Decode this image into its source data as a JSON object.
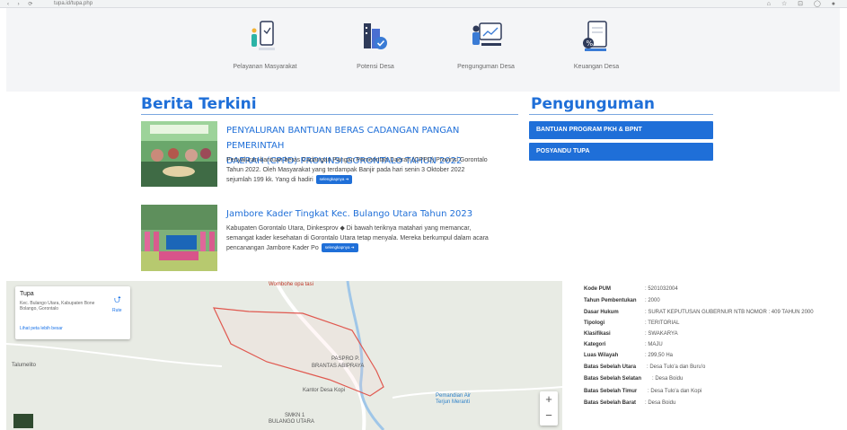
{
  "browser": {
    "url": "tupa.id/tupa.php",
    "nav": "‹ › ⟳",
    "controls": "⌂ ☆ ⊡ ◯ ●"
  },
  "menu": [
    {
      "label": "Pelayanan Masyarakat",
      "icon": "phone-service-icon"
    },
    {
      "label": "Potensi Desa",
      "icon": "buildings-check-icon"
    },
    {
      "label": "Pengunguman Desa",
      "icon": "presentation-board-icon"
    },
    {
      "label": "Keuangan Desa",
      "icon": "finance-document-icon"
    }
  ],
  "news_section": {
    "title": "Berita Terkini",
    "items": [
      {
        "title_lines": [
          "PENYALURAN BANTUAN BERAS CADANGAN PANGAN PEMERINTAH",
          "DAERAH (CPPD) PROVINSI GORONTALO TAHUN 2022"
        ],
        "body_lines": [
          "Penyaluran bantuan beras Cadangan Pangan Pemerintah Daerah (CPPD) Provinsi Gorontalo",
          "Tahun 2022. Oleh Masyarakat yang terdampak Banjir pada hari senin 3 Oktober 2022",
          "sejumlah 199 kk. Yang di hadiri"
        ],
        "more_label": "selengkapnya ➔"
      },
      {
        "title_lines": [
          "Jambore Kader Tingkat Kec. Bulango Utara Tahun 2023"
        ],
        "body_lines": [
          "Kabupaten Gorontalo Utara, Dinkesprov ◆ Di bawah teriknya matahari yang memancar,",
          "semangat kader kesehatan di Gorontalo Utara tetap menyala. Mereka berkumpul dalam acara",
          "pencanangan Jambore Kader Po"
        ],
        "more_label": "selengkapnya ➔"
      }
    ]
  },
  "announcement_section": {
    "title": "Pengunguman",
    "buttons": [
      "BANTUAN PROGRAM PKH & BPNT",
      "POSYANDU TUPA"
    ]
  },
  "map": {
    "place": "Tupa",
    "address": "Kec. Bulango Utara, Kabupaten Bone Bolango, Gorontalo",
    "larger_map": "Lihat peta lebih besar",
    "route": "Rute",
    "labels": [
      "Wombohe opa tasi",
      "Talumelito",
      "PASPRO P.",
      "BRANTAS ABIPRAYA",
      "Kantor Desa Kopi",
      "Pemandian Air",
      "Terjun Meranti",
      "SMKN 1",
      "BULANGO UTARA"
    ],
    "zoom_in": "+",
    "zoom_out": "−"
  },
  "profile": [
    {
      "key": "Kode PUM",
      "value": ": 5201032004"
    },
    {
      "key": "Tahun Pembentukan",
      "value": ": 2000"
    },
    {
      "key": "Dasar Hukum",
      "value": ": SURAT KEPUTUSAN GUBERNUR NTB NOMOR : 409 TAHUN 2000"
    },
    {
      "key": "Tipologi",
      "value": ": TERITORIAL"
    },
    {
      "key": "Klasifikasi",
      "value": ": SWAKARYA"
    },
    {
      "key": "Kategori",
      "value": ": MAJU"
    },
    {
      "key": "Luas Wilayah",
      "value": ": 299,50 Ha"
    }
  ],
  "borders": [
    {
      "key": "Batas Sebelah Utara",
      "value": ": Desa Tulo'a dan Buru'o"
    },
    {
      "key": "Batas Sebelah Selatan",
      "value": ": Desa Boidu"
    },
    {
      "key": "Batas Sebelah Timur",
      "value": ": Desa Tulo'a dan Kopi"
    },
    {
      "key": "Batas Sebelah Barat",
      "value": ": Desa Boidu"
    }
  ],
  "colors": {
    "accent": "#1f6fd8",
    "strip": "#f4f5f7"
  }
}
